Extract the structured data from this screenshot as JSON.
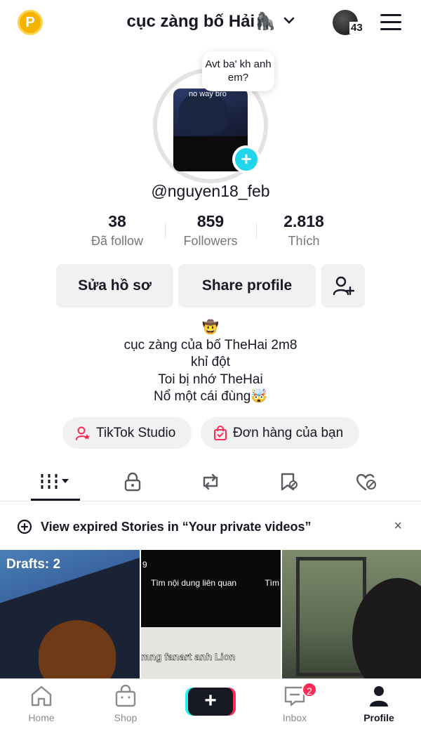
{
  "header": {
    "title": "cục zàng bố Hải🦍",
    "coin_label": "P",
    "avatar_count": "43"
  },
  "profile": {
    "bubble_text": "Avt ba' kh anh em?",
    "avatar_caption": "no way bro",
    "handle": "@nguyen18_feb"
  },
  "stats": [
    {
      "value": "38",
      "label": "Đã follow"
    },
    {
      "value": "859",
      "label": "Followers"
    },
    {
      "value": "2.818",
      "label": "Thích"
    }
  ],
  "buttons": {
    "edit": "Sửa hồ sơ",
    "share": "Share profile"
  },
  "bio": {
    "emoji": "🤠",
    "lines": [
      "cục zàng của bố TheHai 2m8",
      "khỉ đột",
      "Toi bị nhớ TheHai",
      "Nổ một cái đùng🤯"
    ]
  },
  "pills": {
    "studio": "TikTok Studio",
    "orders": "Đơn hàng của bạn"
  },
  "notice": {
    "text": "View expired Stories in “Your private videos”",
    "close": "×"
  },
  "grid": {
    "drafts": "Drafts: 2",
    "search_text": "Tìm nội dung liên quan",
    "search_right": "Tìm",
    "subtitle": "mng fanart anh Lion",
    "left_digit": "9"
  },
  "nav": {
    "home": "Home",
    "shop": "Shop",
    "create": "+",
    "inbox": "Inbox",
    "inbox_badge": "2",
    "profile": "Profile"
  },
  "colors": {
    "accent_cyan": "#20d5ec",
    "accent_red": "#fe2c55",
    "text": "#161823",
    "secondary": "#75767c"
  }
}
